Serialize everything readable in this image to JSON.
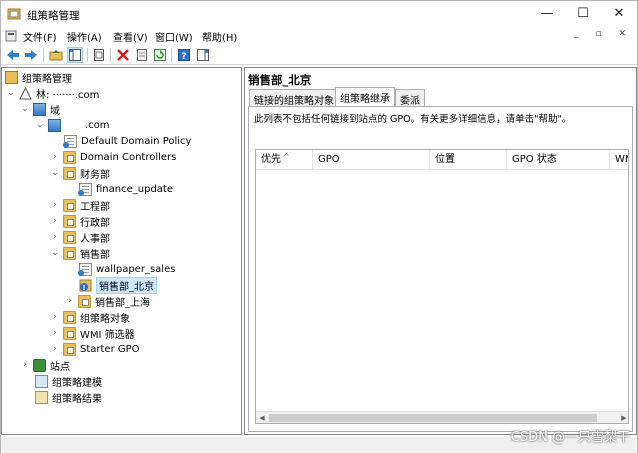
{
  "window": {
    "title": "组策略管理",
    "min": "—",
    "max": "☐",
    "close": "✕"
  },
  "menu": {
    "items": [
      "文件(F)",
      "操作(A)",
      "查看(V)",
      "窗口(W)",
      "帮助(H)"
    ],
    "mdi": "_ ▫ ✕"
  },
  "tree": {
    "root": "组策略管理",
    "forest": "林: ·······.com",
    "domains": "域",
    "domain": ".com",
    "default_policy": "Default Domain Policy",
    "domain_controllers": "Domain Controllers",
    "finance_ou": "财务部",
    "finance_gpo": "finance_update",
    "engineering_ou": "工程部",
    "admin_ou": "行政部",
    "hr_ou": "人事部",
    "sales_ou": "销售部",
    "wallpaper_gpo": "wallpaper_sales",
    "sales_beijing": "销售部_北京",
    "sales_shanghai": "销售部_上海",
    "gpo_objects": "组策略对象",
    "wmi_filters": "WMI 筛选器",
    "starter_gpo": "Starter GPO",
    "sites": "站点",
    "modeling": "组策略建模",
    "results": "组策略结果"
  },
  "right": {
    "heading": "销售部_北京",
    "tabs": [
      "链接的组策略对象",
      "组策略继承",
      "委派"
    ],
    "active_tab": 1,
    "description": "此列表不包括任何链接到站点的 GPO。有关更多详细信息，请单击\"帮助\"。",
    "columns": [
      "优先",
      "GPO",
      "位置",
      "GPO 状态",
      "WM"
    ]
  },
  "watermark": "CSDN @一只雪梨干"
}
